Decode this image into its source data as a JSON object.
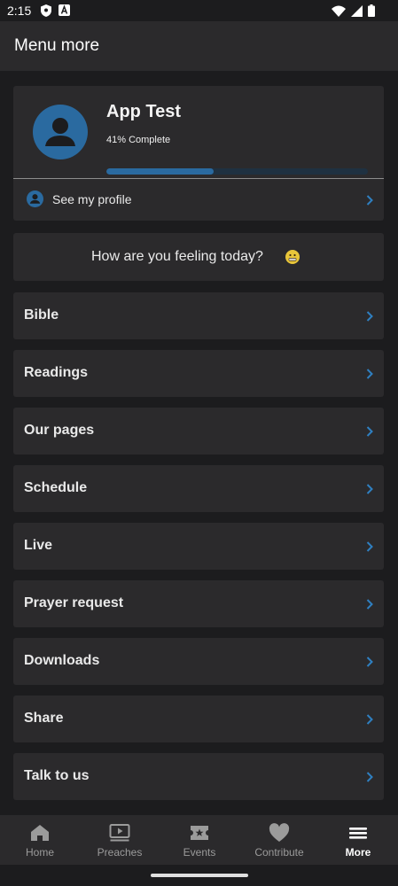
{
  "status_bar": {
    "time": "2:15"
  },
  "app_bar": {
    "title": "Menu more"
  },
  "profile": {
    "name": "App Test",
    "complete_text": "41% Complete",
    "progress_fraction": 0.41,
    "see_profile_label": "See my profile"
  },
  "feeling": {
    "label": "How are you feeling today?",
    "emoji_icon": "grimacing-face-icon"
  },
  "menu": {
    "items": [
      {
        "label": "Bible"
      },
      {
        "label": "Readings"
      },
      {
        "label": "Our pages"
      },
      {
        "label": "Schedule"
      },
      {
        "label": "Live"
      },
      {
        "label": "Prayer request"
      },
      {
        "label": "Downloads"
      },
      {
        "label": "Share"
      },
      {
        "label": "Talk to us"
      }
    ]
  },
  "bottom_nav": {
    "items": [
      {
        "label": "Home",
        "icon": "home-icon"
      },
      {
        "label": "Preaches",
        "icon": "video-play-icon"
      },
      {
        "label": "Events",
        "icon": "ticket-star-icon"
      },
      {
        "label": "Contribute",
        "icon": "heart-icon"
      },
      {
        "label": "More",
        "icon": "menu-bars-icon",
        "active": true
      }
    ]
  },
  "colors": {
    "background": "#1c1c1e",
    "card": "#2b2a2c",
    "accent_blue": "#2a6aa0",
    "chevron_blue": "#2f7fc1",
    "nav_inactive": "#9b9b9b",
    "nav_active": "#ffffff"
  }
}
